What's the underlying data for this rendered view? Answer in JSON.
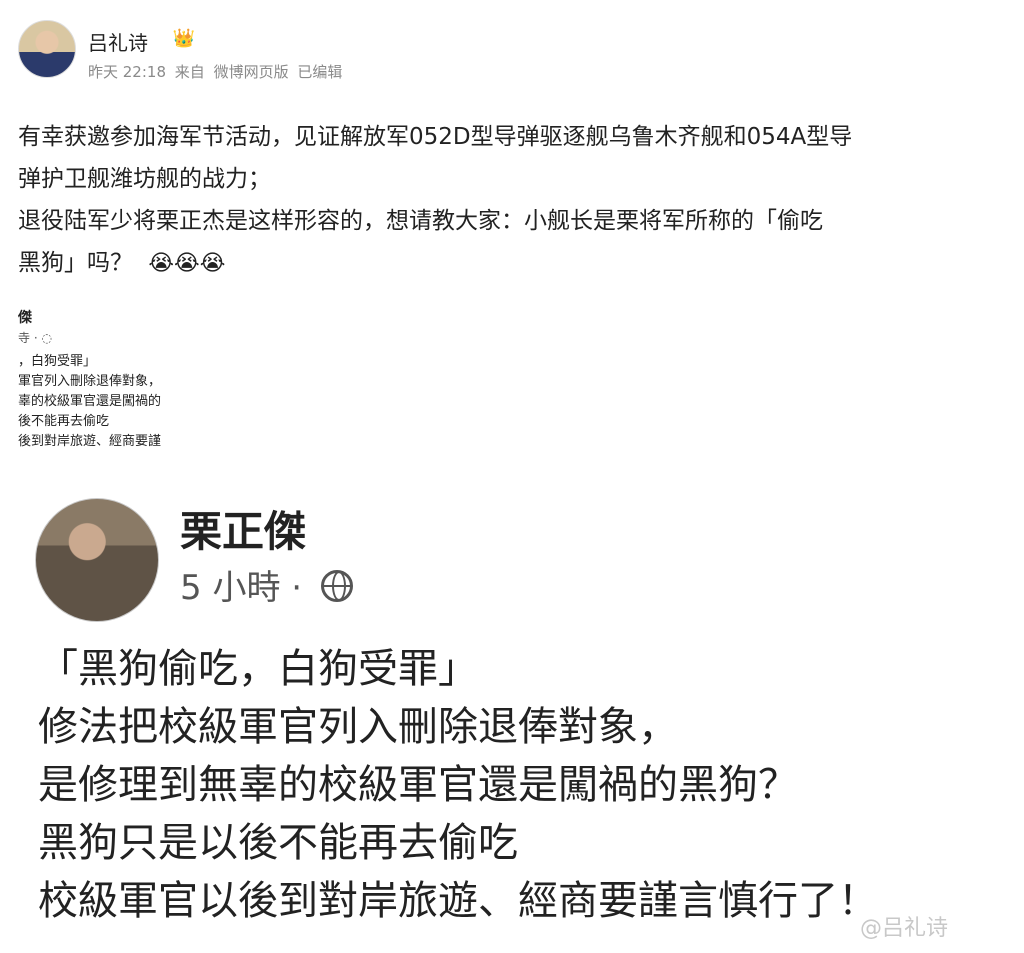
{
  "author": {
    "name": "吕礼诗",
    "vip_badge": "👑"
  },
  "meta": {
    "time": "昨天 22:18",
    "source_prefix": "来自",
    "source": "微博网页版",
    "edited": "已编辑"
  },
  "post": {
    "line1": "有幸获邀参加海军节活动，见证解放军052D型导弹驱逐舰乌鲁木齐舰和054A型导",
    "line2": "弹护卫舰潍坊舰的战力；",
    "line3": "退役陆军少将栗正杰是这样形容的，想请教大家：小舰长是栗将军所称的「偷吃",
    "line4": "黑狗」吗？",
    "emojis": "😭😭😭"
  },
  "small_screenshot": {
    "title": "傑",
    "meta": "寺 ·",
    "lines": [
      "，白狗受罪」",
      "軍官列入刪除退俸對象，",
      "辜的校級軍官還是闖禍的",
      "後不能再去偷吃",
      "後到對岸旅遊、經商要謹"
    ]
  },
  "big_screenshot": {
    "name": "栗正傑",
    "time": "5 小時 ·",
    "lines": [
      "「黑狗偷吃，白狗受罪」",
      "修法把校級軍官列入刪除退俸對象，",
      "是修理到無辜的校級軍官還是闖禍的黑狗？",
      "黑狗只是以後不能再去偷吃",
      "校級軍官以後到對岸旅遊、經商要謹言慎行了！"
    ],
    "watermark": "@吕礼诗"
  },
  "colors": {
    "meta_gray": "#8a8a8a",
    "vip_gold": "#f3a73a"
  }
}
